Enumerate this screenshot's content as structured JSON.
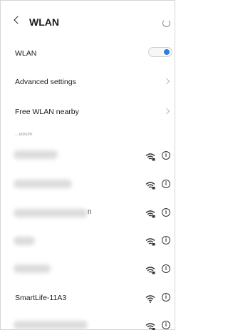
{
  "header": {
    "title": "WLAN"
  },
  "settings": {
    "wlan_label": "WLAN",
    "wlan_enabled": true,
    "advanced_label": "Advanced settings",
    "free_nearby_label": "Free WLAN nearby"
  },
  "section_label": "...etwork",
  "networks": [
    {
      "name": "",
      "secured": true
    },
    {
      "name": "",
      "secured": true
    },
    {
      "name": "",
      "secured": true,
      "visible_tail": "n"
    },
    {
      "name": "",
      "secured": true
    },
    {
      "name": "",
      "secured": true
    },
    {
      "name": "SmartLife-11A3",
      "secured": false
    },
    {
      "name": "",
      "secured": true
    }
  ],
  "colors": {
    "accent": "#2f7fe0",
    "text": "#1a1a1a",
    "muted": "#9a9a9a"
  },
  "icons": {
    "back": "chevron-left-icon",
    "refresh": "refresh-icon",
    "wifi": "wifi-icon",
    "info": "info-icon"
  }
}
